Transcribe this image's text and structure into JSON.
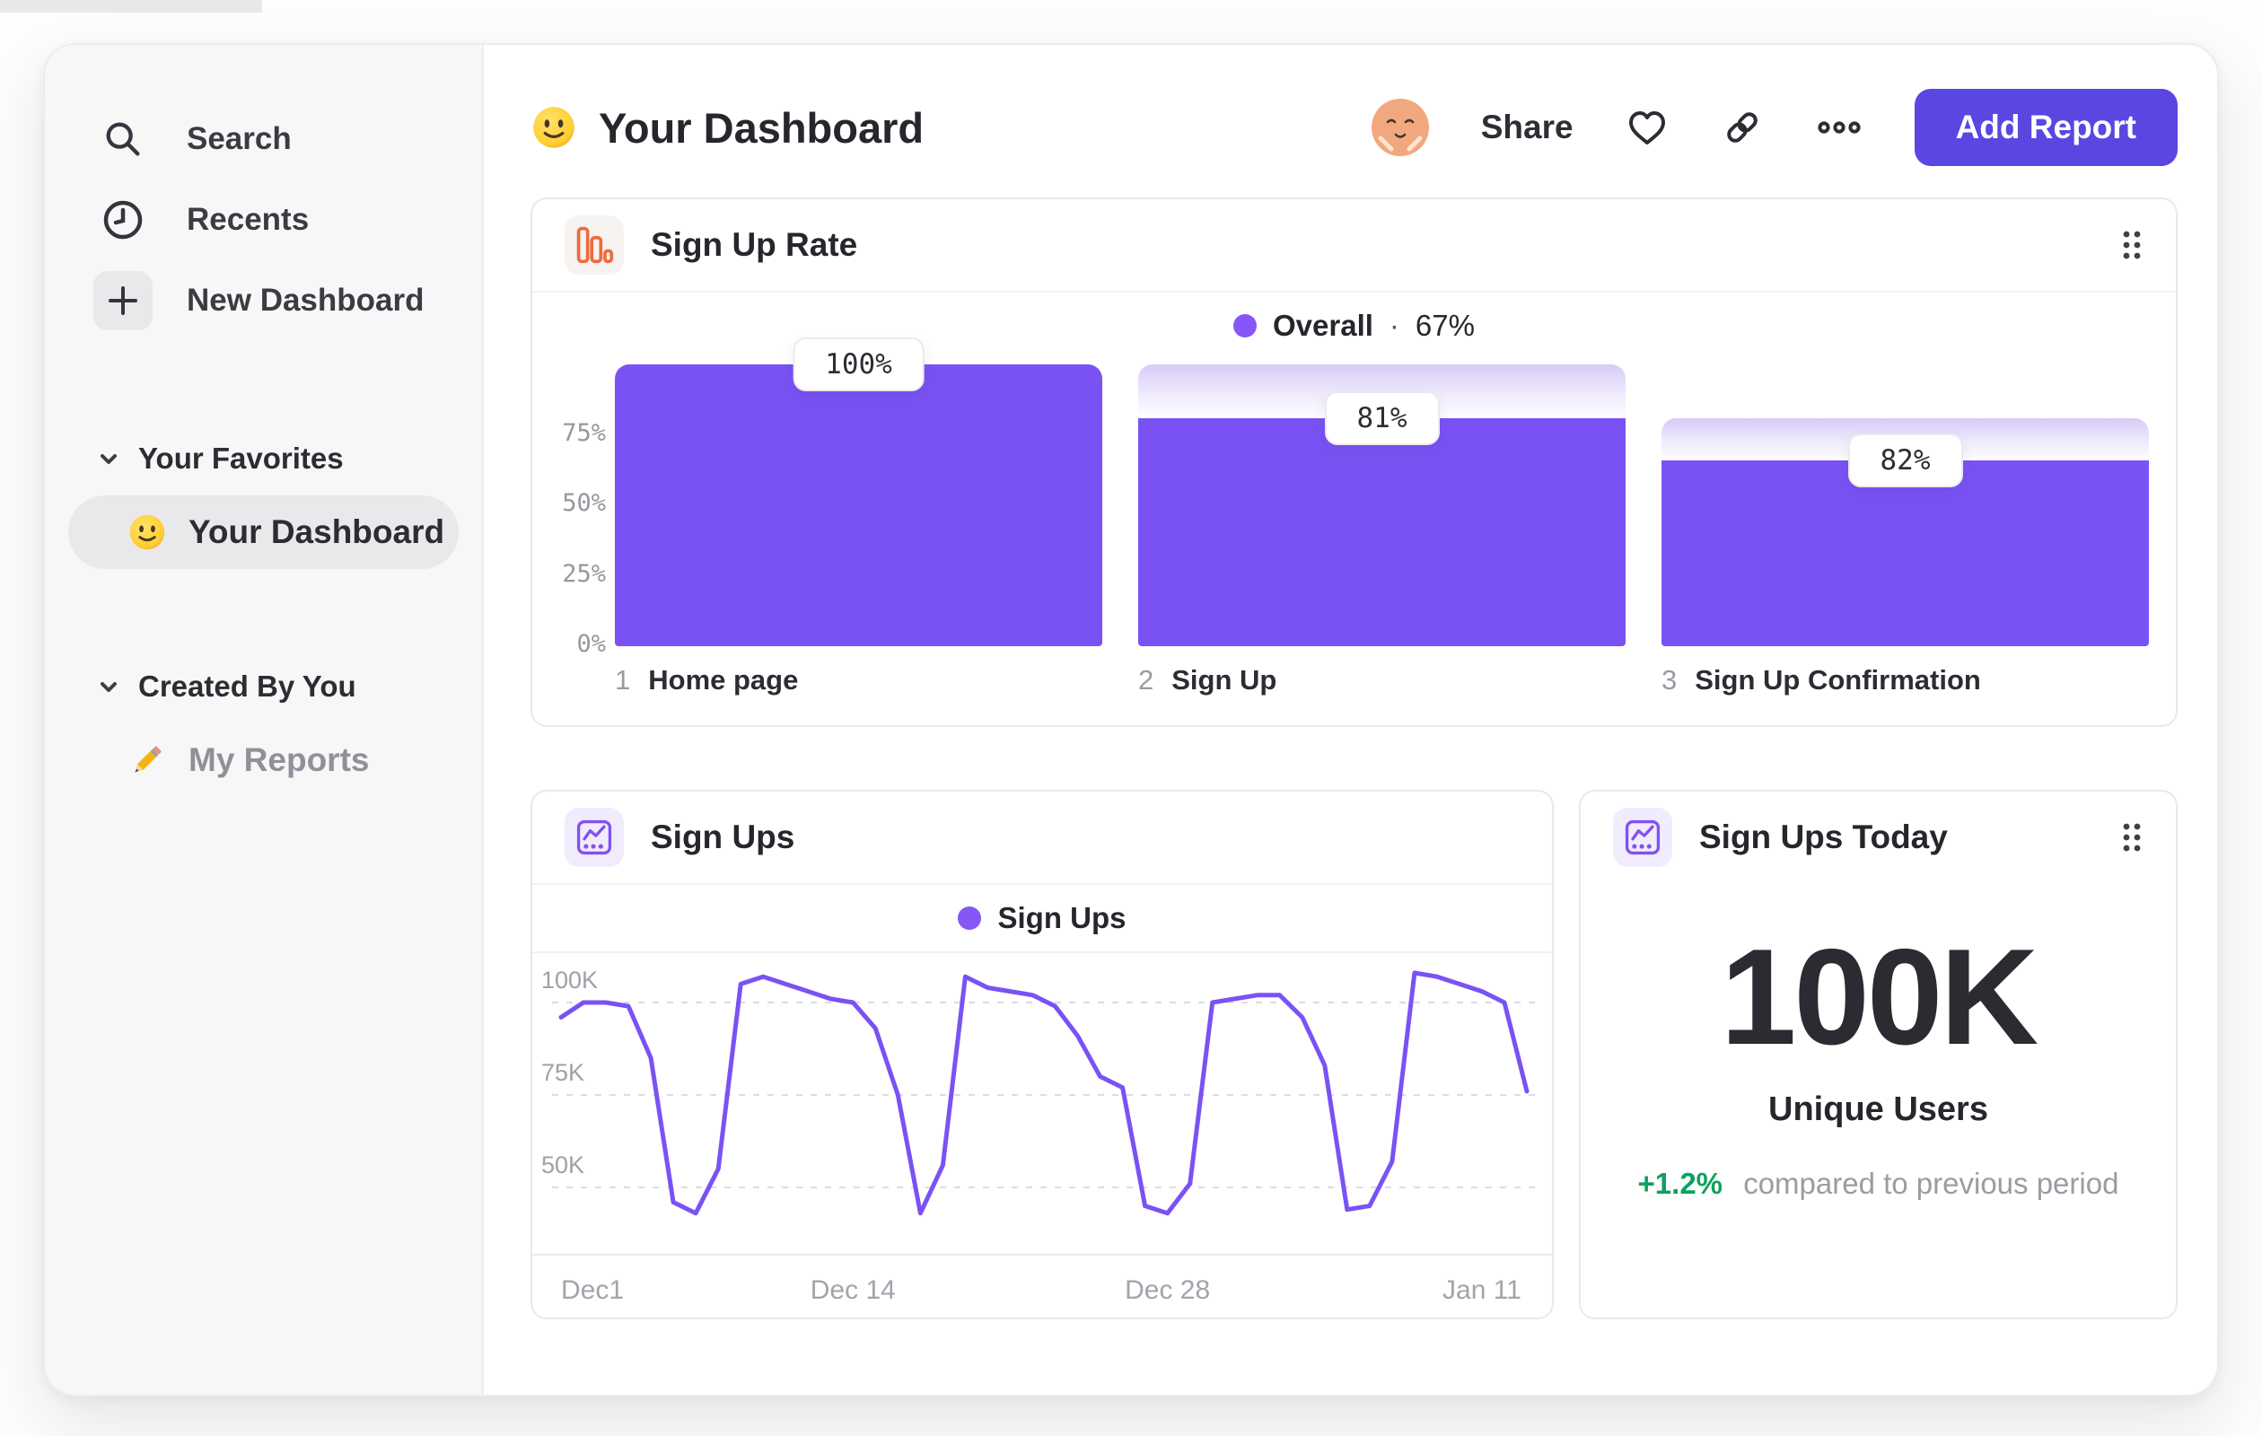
{
  "app": {
    "accent_color": "#5A47E1",
    "chart_purple": "#7A52F4",
    "legend_dot_color": "#8657F6",
    "delta_green": "#0EA15F"
  },
  "sidebar": {
    "items": [
      {
        "label": "Search",
        "icon": "search-icon"
      },
      {
        "label": "Recents",
        "icon": "clock-icon"
      },
      {
        "label": "New Dashboard",
        "icon": "plus-icon"
      }
    ],
    "sections": [
      {
        "title": "Your Favorites",
        "items": [
          {
            "label": "Your Dashboard",
            "icon": "smiley-emoji",
            "selected": true
          }
        ]
      },
      {
        "title": "Created By You",
        "items": [
          {
            "label": "My Reports",
            "icon": "pencil-emoji",
            "selected": false
          }
        ]
      }
    ]
  },
  "header": {
    "emoji_icon": "smiley-emoji",
    "title": "Your Dashboard",
    "avatar_icon": "face-avatar",
    "share_label": "Share",
    "actions": [
      "favorite-heart-icon",
      "copy-link-icon",
      "more-options-icon"
    ],
    "add_report_label": "Add Report"
  },
  "chart_data": [
    {
      "id": "sign_up_rate",
      "type": "bar",
      "subtype": "funnel",
      "title": "Sign Up Rate",
      "icon": "bar-chart-icon",
      "legend": {
        "series": "Overall",
        "separator": "·",
        "value": "67%",
        "position": "top-center"
      },
      "ylim": [
        0,
        100
      ],
      "grid": false,
      "yticks": [
        {
          "label": "75%",
          "value": 75
        },
        {
          "label": "50%",
          "value": 50
        },
        {
          "label": "25%",
          "value": 25
        },
        {
          "label": "0%",
          "value": 0
        }
      ],
      "steps": [
        {
          "index": "1",
          "label": "Home page",
          "conversion_from_previous": "100%",
          "overall_pct": 100
        },
        {
          "index": "2",
          "label": "Sign Up",
          "conversion_from_previous": "81%",
          "overall_pct": 81
        },
        {
          "index": "3",
          "label": "Sign Up Confirmation",
          "conversion_from_previous": "82%",
          "overall_pct": 66
        }
      ],
      "bar_color": "#7A52F4"
    },
    {
      "id": "sign_ups",
      "type": "line",
      "title": "Sign Ups",
      "icon": "line-chart-icon",
      "legend": {
        "series": "Sign Ups",
        "position": "top-center"
      },
      "values_unit": "thousands_of_sign_ups",
      "values": [
        96,
        100,
        100,
        99,
        85,
        46,
        43,
        55,
        105,
        107,
        105,
        103,
        101,
        100,
        93,
        75,
        43,
        56,
        107,
        104,
        103,
        102,
        99,
        91,
        80,
        77,
        45,
        43,
        51,
        100,
        101,
        102,
        102,
        96,
        83,
        44,
        45,
        57,
        108,
        107,
        105,
        103,
        100,
        76
      ],
      "yticks": [
        {
          "label": "100K",
          "value": 100
        },
        {
          "label": "75K",
          "value": 75
        },
        {
          "label": "50K",
          "value": 50
        }
      ],
      "xticks": [
        {
          "label": "Dec1",
          "day_index": 0
        },
        {
          "label": "Dec 14",
          "day_index": 13
        },
        {
          "label": "Dec 28",
          "day_index": 27
        },
        {
          "label": "Jan 11",
          "day_index": 41
        }
      ],
      "grid": "dashed-horizontal",
      "line_color": "#7A52F4"
    },
    {
      "id": "sign_ups_today",
      "type": "big-number",
      "title": "Sign Ups Today",
      "icon": "line-chart-icon",
      "value": "100K",
      "value_label": "Unique Users",
      "delta": "+1.2%",
      "delta_note": "compared to previous period",
      "delta_color": "#0EA15F"
    }
  ]
}
